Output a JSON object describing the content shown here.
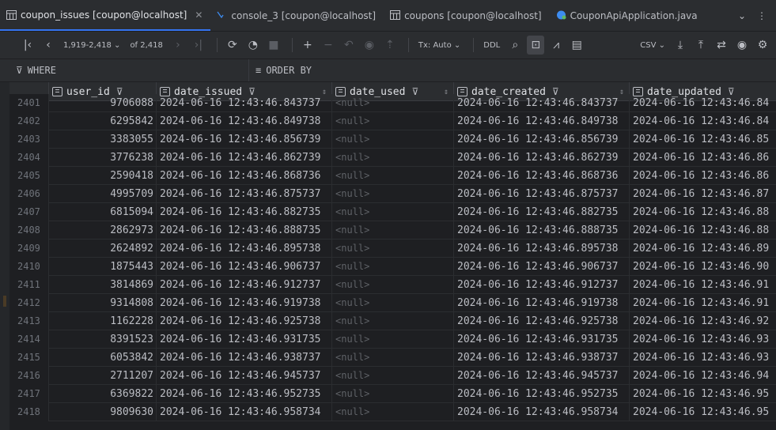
{
  "tabs": [
    {
      "label": "coupon_issues [coupon@localhost]",
      "icon": "table-icon",
      "active": true,
      "closable": true
    },
    {
      "label": "console_3 [coupon@localhost]",
      "icon": "console-icon",
      "active": false
    },
    {
      "label": "coupons [coupon@localhost]",
      "icon": "table-icon",
      "active": false
    },
    {
      "label": "CouponApiApplication.java",
      "icon": "spring-class-icon",
      "active": false
    }
  ],
  "toolbar": {
    "range": "1,919-2,418",
    "total": "of 2,418",
    "tx_mode": "Tx: Auto",
    "ddl": "DDL",
    "export_format": "CSV"
  },
  "filter": {
    "where_label": "WHERE",
    "order_label": "ORDER BY"
  },
  "columns": [
    "user_id",
    "date_issued",
    "date_used",
    "date_created",
    "date_updated"
  ],
  "rows": [
    {
      "n": "2401",
      "user_id": "9706088",
      "date_issued": "2024-06-16 12:43:46.843737",
      "date_used": "<null>",
      "date_created": "2024-06-16 12:43:46.843737",
      "date_updated": "2024-06-16 12:43:46.84"
    },
    {
      "n": "2402",
      "user_id": "6295842",
      "date_issued": "2024-06-16 12:43:46.849738",
      "date_used": "<null>",
      "date_created": "2024-06-16 12:43:46.849738",
      "date_updated": "2024-06-16 12:43:46.84"
    },
    {
      "n": "2403",
      "user_id": "3383055",
      "date_issued": "2024-06-16 12:43:46.856739",
      "date_used": "<null>",
      "date_created": "2024-06-16 12:43:46.856739",
      "date_updated": "2024-06-16 12:43:46.85"
    },
    {
      "n": "2404",
      "user_id": "3776238",
      "date_issued": "2024-06-16 12:43:46.862739",
      "date_used": "<null>",
      "date_created": "2024-06-16 12:43:46.862739",
      "date_updated": "2024-06-16 12:43:46.86"
    },
    {
      "n": "2405",
      "user_id": "2590418",
      "date_issued": "2024-06-16 12:43:46.868736",
      "date_used": "<null>",
      "date_created": "2024-06-16 12:43:46.868736",
      "date_updated": "2024-06-16 12:43:46.86"
    },
    {
      "n": "2406",
      "user_id": "4995709",
      "date_issued": "2024-06-16 12:43:46.875737",
      "date_used": "<null>",
      "date_created": "2024-06-16 12:43:46.875737",
      "date_updated": "2024-06-16 12:43:46.87"
    },
    {
      "n": "2407",
      "user_id": "6815094",
      "date_issued": "2024-06-16 12:43:46.882735",
      "date_used": "<null>",
      "date_created": "2024-06-16 12:43:46.882735",
      "date_updated": "2024-06-16 12:43:46.88"
    },
    {
      "n": "2408",
      "user_id": "2862973",
      "date_issued": "2024-06-16 12:43:46.888735",
      "date_used": "<null>",
      "date_created": "2024-06-16 12:43:46.888735",
      "date_updated": "2024-06-16 12:43:46.88"
    },
    {
      "n": "2409",
      "user_id": "2624892",
      "date_issued": "2024-06-16 12:43:46.895738",
      "date_used": "<null>",
      "date_created": "2024-06-16 12:43:46.895738",
      "date_updated": "2024-06-16 12:43:46.89"
    },
    {
      "n": "2410",
      "user_id": "1875443",
      "date_issued": "2024-06-16 12:43:46.906737",
      "date_used": "<null>",
      "date_created": "2024-06-16 12:43:46.906737",
      "date_updated": "2024-06-16 12:43:46.90"
    },
    {
      "n": "2411",
      "user_id": "3814869",
      "date_issued": "2024-06-16 12:43:46.912737",
      "date_used": "<null>",
      "date_created": "2024-06-16 12:43:46.912737",
      "date_updated": "2024-06-16 12:43:46.91"
    },
    {
      "n": "2412",
      "user_id": "9314808",
      "date_issued": "2024-06-16 12:43:46.919738",
      "date_used": "<null>",
      "date_created": "2024-06-16 12:43:46.919738",
      "date_updated": "2024-06-16 12:43:46.91"
    },
    {
      "n": "2413",
      "user_id": "1162228",
      "date_issued": "2024-06-16 12:43:46.925738",
      "date_used": "<null>",
      "date_created": "2024-06-16 12:43:46.925738",
      "date_updated": "2024-06-16 12:43:46.92"
    },
    {
      "n": "2414",
      "user_id": "8391523",
      "date_issued": "2024-06-16 12:43:46.931735",
      "date_used": "<null>",
      "date_created": "2024-06-16 12:43:46.931735",
      "date_updated": "2024-06-16 12:43:46.93"
    },
    {
      "n": "2415",
      "user_id": "6053842",
      "date_issued": "2024-06-16 12:43:46.938737",
      "date_used": "<null>",
      "date_created": "2024-06-16 12:43:46.938737",
      "date_updated": "2024-06-16 12:43:46.93"
    },
    {
      "n": "2416",
      "user_id": "2711207",
      "date_issued": "2024-06-16 12:43:46.945737",
      "date_used": "<null>",
      "date_created": "2024-06-16 12:43:46.945737",
      "date_updated": "2024-06-16 12:43:46.94"
    },
    {
      "n": "2417",
      "user_id": "6369822",
      "date_issued": "2024-06-16 12:43:46.952735",
      "date_used": "<null>",
      "date_created": "2024-06-16 12:43:46.952735",
      "date_updated": "2024-06-16 12:43:46.95"
    },
    {
      "n": "2418",
      "user_id": "9809630",
      "date_issued": "2024-06-16 12:43:46.958734",
      "date_used": "<null>",
      "date_created": "2024-06-16 12:43:46.958734",
      "date_updated": "2024-06-16 12:43:46.95"
    }
  ],
  "colors": {
    "accent": "#3574f0",
    "background": "#1e1f22",
    "panel": "#2b2d30",
    "null_text": "#5f6267"
  }
}
